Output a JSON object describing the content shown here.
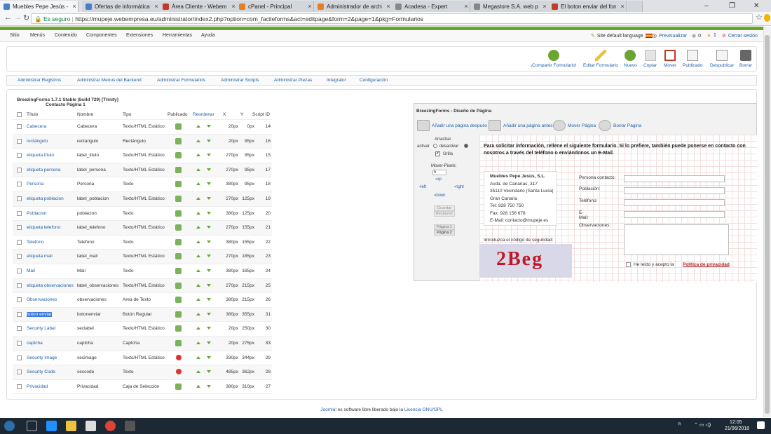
{
  "browser": {
    "tabs": [
      {
        "title": "Muebles Pepe Jesús - Ad",
        "color": "#4a7cc9",
        "active": true
      },
      {
        "title": "Ofertas de informática -",
        "color": "#4a7cc9"
      },
      {
        "title": "Área Cliente - Webempr",
        "color": "#c0392b"
      },
      {
        "title": "cPanel - Principal",
        "color": "#e67e22"
      },
      {
        "title": "Administrador de archivo",
        "color": "#e67e22"
      },
      {
        "title": "Acadesa - Expert",
        "color": "#888888"
      },
      {
        "title": "Megastore S.A. web priv",
        "color": "#888888"
      },
      {
        "title": "El boton enviar del form",
        "color": "#c0392b"
      }
    ],
    "tab_close": "×",
    "secure": "Es seguro",
    "url": "https://mupeje.webempresa.eu/administrator/index2.php?option=com_facileforms&act=editpage&form=2&page=1&pkg=Formularios",
    "win": [
      "–",
      "❐",
      "✕"
    ]
  },
  "topmenu": {
    "items": [
      "Sitio",
      "Menús",
      "Contenido",
      "Componentes",
      "Extensiones",
      "Herramientas",
      "Ayuda"
    ],
    "right": {
      "lang": "Site default language",
      "preview": "Previsualizar",
      "c1": "0",
      "c2": "1",
      "logout": "Cerrar sesión"
    }
  },
  "toolbar": [
    "¡Compartir Formulario!",
    "Editar Formulario",
    "Nuevo",
    "Copiar",
    "Mover",
    "Publicado",
    "Despublicar",
    "Borrar"
  ],
  "submenu": [
    "Administrar Registros",
    "Administrar Menus del Backend",
    "Administrar Formularios",
    "Administrar Scripts",
    "Administrar Piezas",
    "Integrator",
    "Configuración"
  ],
  "version": {
    "line1": "BreezingForms 1.7.1 Stable (build 729) [Trinity]",
    "line2": "Contacto Página 1"
  },
  "table": {
    "headers": [
      "Título",
      "Nombre",
      "Tipo",
      "Publicado",
      "Reordenar",
      "X",
      "Y",
      "Script ID"
    ],
    "rows": [
      [
        "Cabecera",
        "Cabecera",
        "Texto/HTML Estático",
        "ok",
        "20px",
        "0px",
        "14"
      ],
      [
        "rectángulo",
        "rectangulo",
        "Rectángulo",
        "ok",
        "20px",
        "95px",
        "16"
      ],
      [
        "etiqueta título",
        "label_titulo",
        "Texto/HTML Estático",
        "ok",
        "270px",
        "95px",
        "15"
      ],
      [
        "etiqueta persona",
        "label_persona",
        "Texto/HTML Estático",
        "ok",
        "270px",
        "95px",
        "17"
      ],
      [
        "Persona",
        "Persona",
        "Texto",
        "ok",
        "380px",
        "95px",
        "18"
      ],
      [
        "etiqueta poblacion",
        "label_poblacion",
        "Texto/HTML Estático",
        "ok",
        "270px",
        "125px",
        "19"
      ],
      [
        "Poblacion",
        "poblacion",
        "Texto",
        "ok",
        "380px",
        "125px",
        "20"
      ],
      [
        "etiqueta telefono",
        "label_telefono",
        "Texto/HTML Estático",
        "ok",
        "270px",
        "155px",
        "21"
      ],
      [
        "Telefono",
        "Telefono",
        "Texto",
        "ok",
        "380px",
        "155px",
        "22"
      ],
      [
        "etiqueta mail",
        "label_mail",
        "Texto/HTML Estático",
        "ok",
        "270px",
        "185px",
        "23"
      ],
      [
        "Mail",
        "Mail",
        "Texto",
        "ok",
        "380px",
        "185px",
        "24"
      ],
      [
        "etiqueta observaciones",
        "label_observaciones",
        "Texto/HTML Estático",
        "ok",
        "270px",
        "215px",
        "25"
      ],
      [
        "Observaciones",
        "observaciones",
        "Area de Texto",
        "ok",
        "380px",
        "215px",
        "26"
      ],
      [
        "boton enviar",
        "botonenviar",
        "Botón Regular",
        "ok",
        "380px",
        "355px",
        "31"
      ],
      [
        "Security Label",
        "seclabel",
        "Texto/HTML Estático",
        "ok",
        "20px",
        "250px",
        "30"
      ],
      [
        "captcha",
        "captcha",
        "Captcha",
        "ok",
        "20px",
        "275px",
        "33"
      ],
      [
        "Security Image",
        "secimage",
        "Texto/HTML Estático",
        "no",
        "330px",
        "344px",
        "29"
      ],
      [
        "Security Code",
        "seccode",
        "Texto",
        "no",
        "485px",
        "362px",
        "28"
      ],
      [
        "Privacidad",
        "Privacidad",
        "Caja de Selección",
        "ok",
        "380px",
        "310px",
        "27"
      ]
    ]
  },
  "design": {
    "title": "BreezingForms - Diseño de Página",
    "actions": [
      "Añadir una página después",
      "Añadir una página antes",
      "Mover Página",
      "Borrar Página"
    ],
    "ctrl": {
      "drag": "Arrastrar",
      "activate": "activar",
      "deactivate": "desactivar",
      "grid": "Grilla",
      "move": "Mover-Pixels:",
      "pixels": "5",
      "up": "up",
      "left": "left",
      "right": "right",
      "down": "down",
      "save": "Guardar",
      "restore": "Restaurar",
      "page1": "Página 1",
      "page2": "Página 2"
    },
    "intro": "Para solicitar información, rellene el siguiente formulario. Si lo prefiere, también puede ponerse en contacto con nosotros  a través del teléfono o enviándonos un E-Mail.",
    "address": [
      "Muebles Pepe Jesús, S.L.",
      "Avda. de Canarias, 317",
      "35110 Vecindario (Santa Lucía)",
      "Gran Canaria",
      "Tel: 928 750 750",
      "Fax: 928 156 678",
      "E-Mail: contacto@mupeje.es"
    ],
    "labels": [
      "Persona contacto:",
      "Población:",
      "Teléfono:",
      "E-Mail:",
      "Observaciones:"
    ],
    "security": "Introduzca el código de seguridad:",
    "captcha": "2Beg",
    "privacy": "He leído y acepto la",
    "privacy_link": "Política de privacidad"
  },
  "footer": {
    "pre": "Joomla!",
    "text": " es software libre liberado bajo la ",
    "link": "Licencia GNU/GPL"
  },
  "taskbar": {
    "time": "12:05",
    "date": "21/06/2018"
  }
}
